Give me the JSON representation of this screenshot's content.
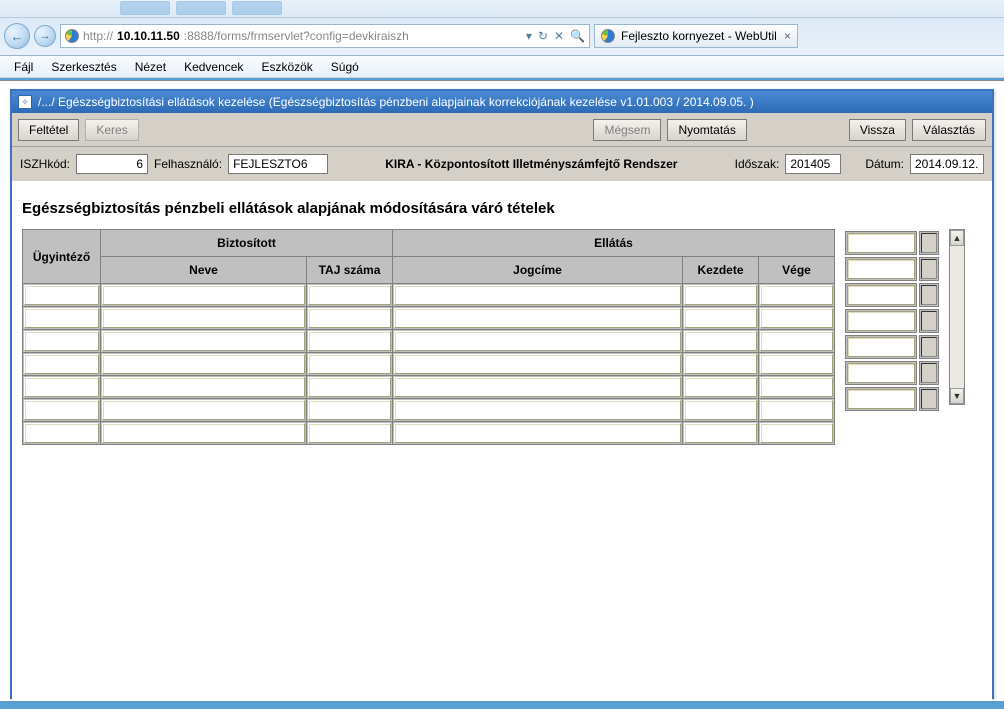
{
  "browser": {
    "url_scheme": "http://",
    "url_host": "10.10.11.50",
    "url_rest": ":8888/forms/frmservlet?config=devkiraiszh",
    "refresh_glyph": "↻",
    "stop_glyph": "✕",
    "tab_title": "Fejleszto kornyezet - WebUtil",
    "tab_close": "×",
    "back_glyph": "←",
    "fwd_glyph": "→",
    "dropdown_glyph": "▾",
    "search_glyph": "🔍"
  },
  "menu": {
    "items": [
      "Fájl",
      "Szerkesztés",
      "Nézet",
      "Kedvencek",
      "Eszközök",
      "Súgó"
    ]
  },
  "window": {
    "title": "/.../ Egészségbiztosítási ellátások kezelése (Egészségbiztosítás pénzbeni alapjainak korrekciójának kezelése v1.01.003 / 2014.09.05. )",
    "icon_glyph": "✧"
  },
  "toolbar": {
    "feltetel": "Feltétel",
    "keres": "Keres",
    "megsem": "Mégsem",
    "nyomtatas": "Nyomtatás",
    "vissza": "Vissza",
    "valasztas": "Választás"
  },
  "info": {
    "iszh_label": "ISZHkód:",
    "iszh_value": "6",
    "felh_label": "Felhasználó:",
    "felh_value": "FEJLESZTO6",
    "center": "KIRA - Központosított Illetményszámfejtő Rendszer",
    "idoszak_label": "Időszak:",
    "idoszak_value": "201405",
    "datum_label": "Dátum:",
    "datum_value": "2014.09.12."
  },
  "section_title": "Egészségbiztosítás pénzbeli ellátások alapjának módosítására váró tételek",
  "headers": {
    "ugyintezo": "Ügyintéző",
    "biztositott": "Biztosított",
    "ellatas": "Ellátás",
    "neve": "Neve",
    "taj": "TAJ száma",
    "jogcime": "Jogcíme",
    "kezdete": "Kezdete",
    "vege": "Vége"
  },
  "scroll": {
    "up": "▲",
    "down": "▼"
  }
}
